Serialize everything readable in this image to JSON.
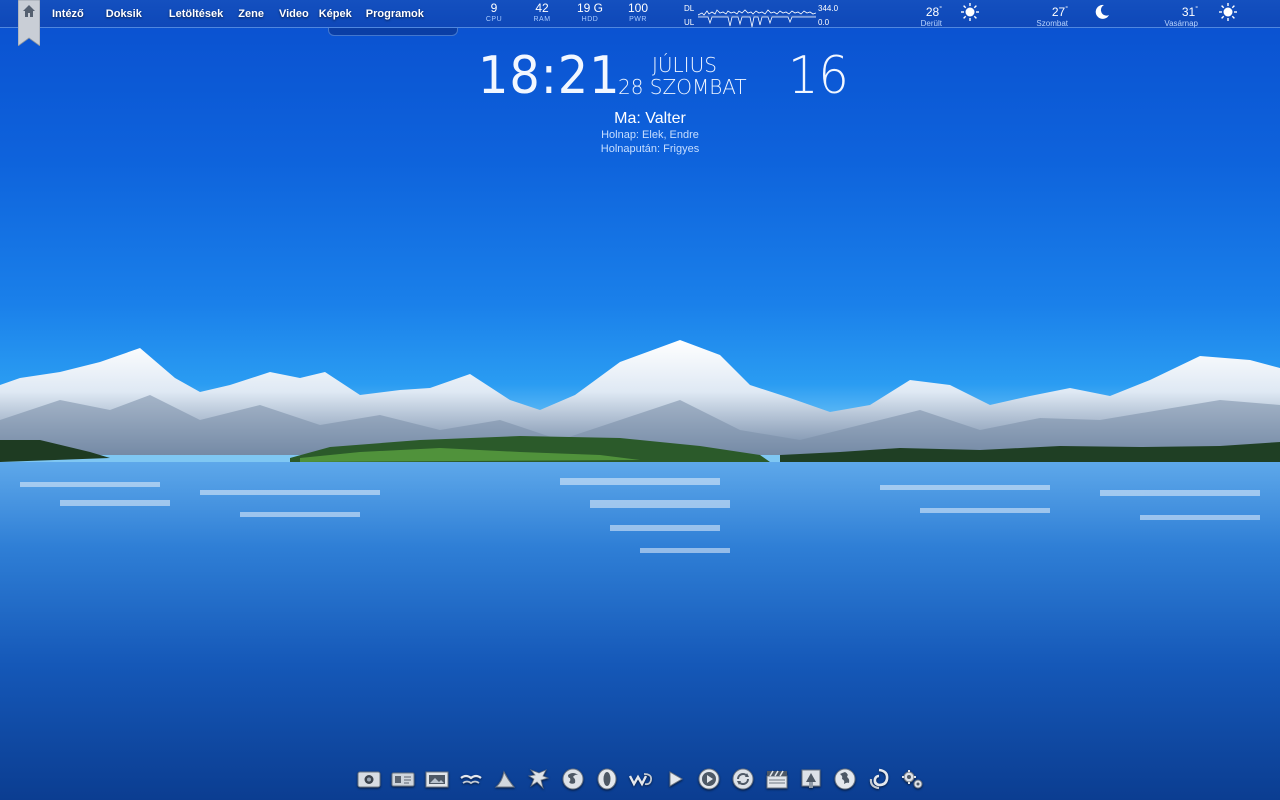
{
  "topbar": {
    "nav": [
      "Intéző",
      "Doksik",
      "Letöltések",
      "Zene",
      "Video",
      "Képek",
      "Programok"
    ],
    "stats": [
      {
        "value": "9",
        "label": "CPU"
      },
      {
        "value": "42",
        "label": "RAM"
      },
      {
        "value": "19 G",
        "label": "HDD"
      },
      {
        "value": "100",
        "label": "PWR"
      }
    ],
    "network": {
      "dl_label": "DL",
      "ul_label": "UL",
      "dl_value": "344.0",
      "ul_value": "0.0"
    },
    "weather": [
      {
        "temp": "28",
        "unit": "°",
        "desc": "Derült",
        "icon": "sun-icon"
      },
      {
        "temp": "27",
        "unit": "°",
        "desc": "Szombat",
        "icon": "moon-icon"
      },
      {
        "temp": "31",
        "unit": "°",
        "desc": "Vasárnap",
        "icon": "sun-icon"
      }
    ]
  },
  "clock": {
    "time": "18:21",
    "month": "JÚLIUS",
    "day": "28 SZOMBAT",
    "temperature": "16"
  },
  "namedays": {
    "today": "Ma: Valter",
    "tomorrow": "Holnap: Elek, Endre",
    "day_after": "Holnapután: Frigyes"
  },
  "dock": {
    "icons": [
      "camera-icon",
      "ticket-icon",
      "photo-frame-icon",
      "birds-icon",
      "shark-fin-icon",
      "dragon-icon",
      "firefox-icon",
      "opera-icon",
      "winamp-icon",
      "play-icon",
      "media-player-icon",
      "update-icon",
      "clapperboard-icon",
      "paint-icon",
      "globe-icon",
      "vortex-icon",
      "settings-icon"
    ]
  },
  "colors": {
    "accent": "#0e63dc",
    "label": "#a9cbff"
  }
}
